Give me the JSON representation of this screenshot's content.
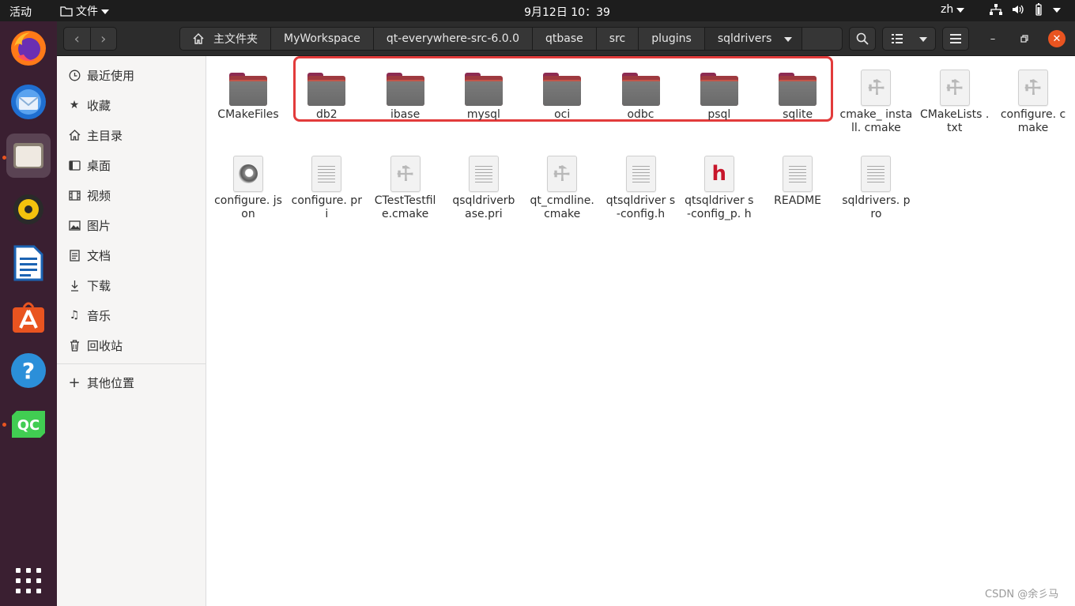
{
  "topbar": {
    "activities": "活动",
    "app_menu": "文件",
    "clock": "9月12日  10：39",
    "lang": "zh"
  },
  "dock": {
    "items": [
      {
        "name": "firefox",
        "running": false
      },
      {
        "name": "thunderbird",
        "running": false
      },
      {
        "name": "files",
        "running": true
      },
      {
        "name": "rhythmbox",
        "running": false
      },
      {
        "name": "libreoffice-writer",
        "running": false
      },
      {
        "name": "ubuntu-software",
        "running": false
      },
      {
        "name": "help",
        "running": false
      },
      {
        "name": "qt-creator",
        "running": true,
        "label": "QC"
      }
    ]
  },
  "header": {
    "breadcrumbs": [
      "主文件夹",
      "MyWorkspace",
      "qt-everywhere-src-6.0.0",
      "qtbase",
      "src",
      "plugins",
      "sqldrivers"
    ]
  },
  "sidebar": {
    "items": [
      {
        "label": "最近使用",
        "icon": "clock-icon"
      },
      {
        "label": "收藏",
        "icon": "star-icon"
      },
      {
        "label": "主目录",
        "icon": "home-icon"
      },
      {
        "label": "桌面",
        "icon": "desktop-icon"
      },
      {
        "label": "视频",
        "icon": "video-icon"
      },
      {
        "label": "图片",
        "icon": "image-icon"
      },
      {
        "label": "文档",
        "icon": "document-icon"
      },
      {
        "label": "下载",
        "icon": "download-icon"
      },
      {
        "label": "音乐",
        "icon": "music-icon"
      },
      {
        "label": "回收站",
        "icon": "trash-icon"
      }
    ],
    "other": {
      "label": "其他位置",
      "icon": "plus-icon"
    }
  },
  "files": [
    {
      "name": "CMakeFiles",
      "type": "folder"
    },
    {
      "name": "db2",
      "type": "folder"
    },
    {
      "name": "ibase",
      "type": "folder"
    },
    {
      "name": "mysql",
      "type": "folder"
    },
    {
      "name": "oci",
      "type": "folder"
    },
    {
      "name": "odbc",
      "type": "folder"
    },
    {
      "name": "psql",
      "type": "folder"
    },
    {
      "name": "sqlite",
      "type": "folder"
    },
    {
      "name": "cmake_ install. cmake",
      "type": "build"
    },
    {
      "name": "CMakeLists .txt",
      "type": "build"
    },
    {
      "name": "configure. cmake",
      "type": "build"
    },
    {
      "name": "configure. json",
      "type": "json"
    },
    {
      "name": "configure. pri",
      "type": "text"
    },
    {
      "name": "CTestTestfil e.cmake",
      "type": "build"
    },
    {
      "name": "qsqldriverb ase.pri",
      "type": "text"
    },
    {
      "name": "qt_cmdline. cmake",
      "type": "build"
    },
    {
      "name": "qtsqldriver s-config.h",
      "type": "text"
    },
    {
      "name": "qtsqldriver s-config_p. h",
      "type": "header"
    },
    {
      "name": "README",
      "type": "text"
    },
    {
      "name": "sqldrivers. pro",
      "type": "text"
    }
  ],
  "highlight_color": "#e23b3b",
  "accent": "#e95420",
  "watermark": "CSDN @余彡马"
}
